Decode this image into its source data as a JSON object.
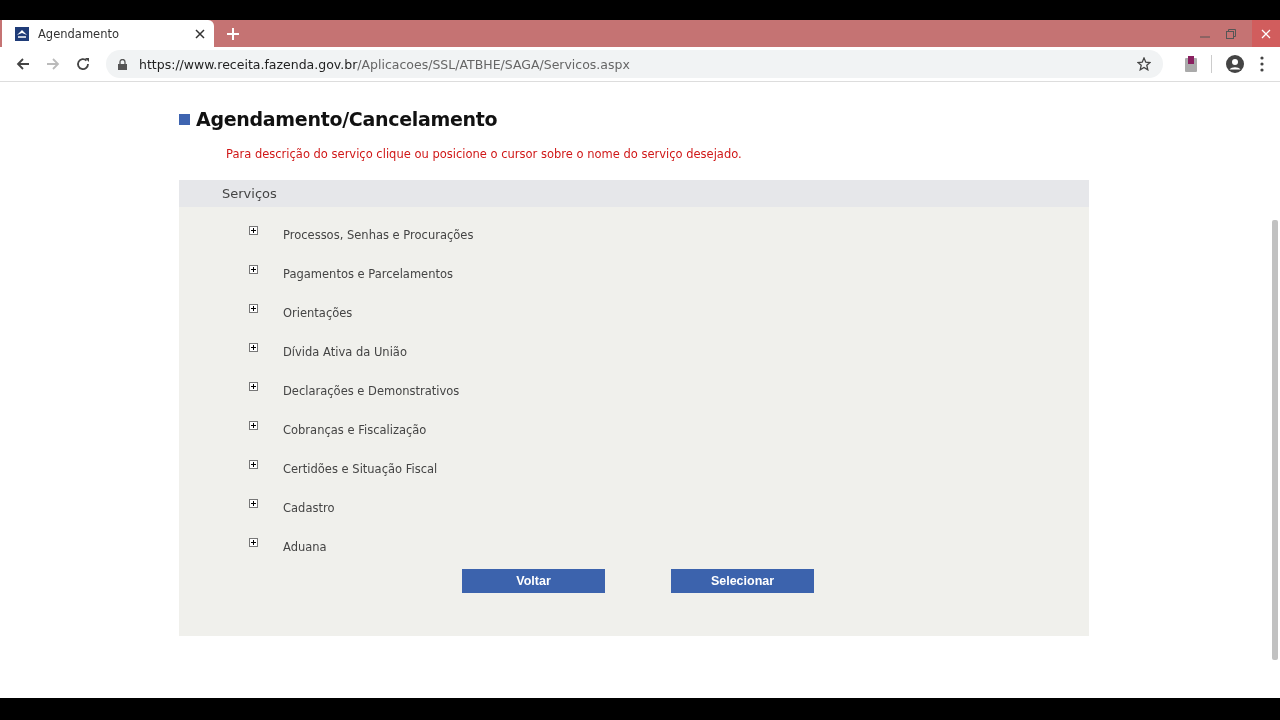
{
  "browser": {
    "tab_title": "Agendamento",
    "url_host": "https://www.receita.fazenda.gov.br",
    "url_path": "/Aplicacoes/SSL/ATBHE/SAGA/Servicos.aspx"
  },
  "page": {
    "title": "Agendamento/Cancelamento",
    "instruction": "Para descrição do serviço clique ou posicione o cursor sobre o nome do serviço desejado.",
    "panel_header": "Serviços",
    "services": [
      {
        "label": "Processos, Senhas e Procurações",
        "expanded": false
      },
      {
        "label": "Pagamentos e Parcelamentos",
        "expanded": false
      },
      {
        "label": "Orientações",
        "expanded": false
      },
      {
        "label": "Dívida Ativa da União",
        "expanded": false
      },
      {
        "label": "Declarações e Demonstrativos",
        "expanded": false
      },
      {
        "label": "Cobranças e Fiscalização",
        "expanded": false
      },
      {
        "label": "Certidões e Situação Fiscal",
        "expanded": false
      },
      {
        "label": "Cadastro",
        "expanded": false
      },
      {
        "label": "Aduana",
        "expanded": false
      }
    ],
    "buttons": [
      "Voltar",
      "Selecionar"
    ]
  }
}
